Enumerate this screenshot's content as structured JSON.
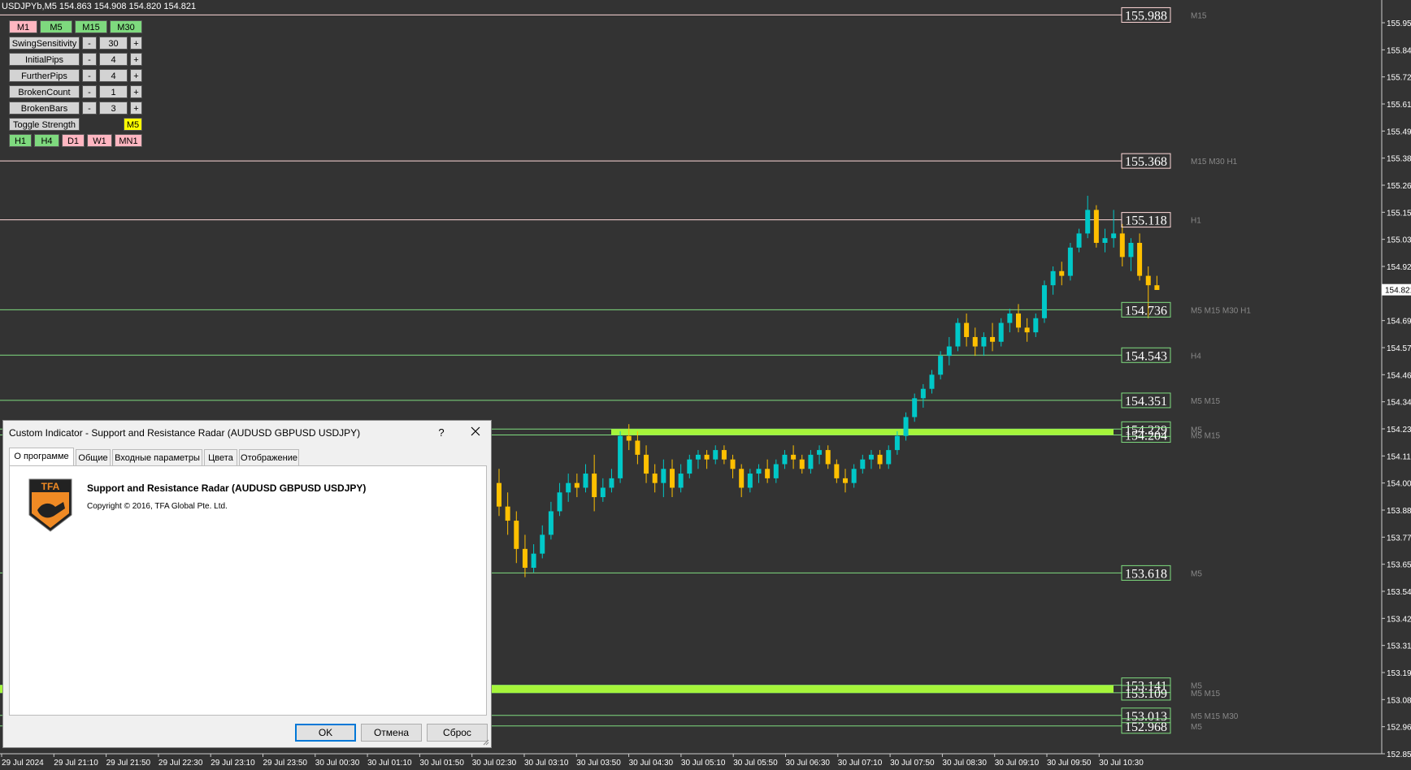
{
  "header": {
    "symbol": "USDJPYb,M5",
    "ohlc": "154.863 154.908 154.820 154.821"
  },
  "colors": {
    "background": "#333333",
    "bull": "#00c8c8",
    "bear": "#ffc000",
    "zone": "#a6f53a",
    "res_line": "#ffd8d8",
    "sup_line": "#7fdc7f"
  },
  "panel": {
    "top_tf": [
      {
        "label": "M1",
        "color": "pink"
      },
      {
        "label": "M5",
        "color": "green"
      },
      {
        "label": "M15",
        "color": "green"
      },
      {
        "label": "M30",
        "color": "green"
      }
    ],
    "params": [
      {
        "label": "SwingSensitivity",
        "minus": "-",
        "value": "30",
        "plus": "+"
      },
      {
        "label": "InitialPips",
        "minus": "-",
        "value": "4",
        "plus": "+"
      },
      {
        "label": "FurtherPips",
        "minus": "-",
        "value": "4",
        "plus": "+"
      },
      {
        "label": "BrokenCount",
        "minus": "-",
        "value": "1",
        "plus": "+"
      },
      {
        "label": "BrokenBars",
        "minus": "-",
        "value": "3",
        "plus": "+"
      }
    ],
    "toggle_label": "Toggle Strength",
    "toggle_tf": "M5",
    "bottom_tf": [
      {
        "label": "H1",
        "color": "green"
      },
      {
        "label": "H4",
        "color": "green"
      },
      {
        "label": "D1",
        "color": "pink"
      },
      {
        "label": "W1",
        "color": "pink"
      },
      {
        "label": "MN1",
        "color": "pink"
      }
    ]
  },
  "levels": [
    {
      "price": "155.988",
      "type": "res",
      "tf": "M15"
    },
    {
      "price": "155.368",
      "type": "res",
      "tf": "M15 M30 H1"
    },
    {
      "price": "155.118",
      "type": "res",
      "tf": "H1"
    },
    {
      "price": "154.736",
      "type": "sup",
      "tf": "M5 M15 M30 H1"
    },
    {
      "price": "154.543",
      "type": "sup",
      "tf": "H4"
    },
    {
      "price": "154.351",
      "type": "sup",
      "tf": "M5 M15"
    },
    {
      "price": "154.229",
      "type": "sup",
      "tf": "M5"
    },
    {
      "price": "154.204",
      "type": "sup",
      "tf": "M5 M15"
    },
    {
      "price": "153.618",
      "type": "sup",
      "tf": "M5"
    },
    {
      "price": "153.141",
      "type": "sup",
      "tf": "M5"
    },
    {
      "price": "153.109",
      "type": "sup",
      "tf": "M5 M15"
    },
    {
      "price": "153.013",
      "type": "sup",
      "tf": "M5 M15 M30"
    },
    {
      "price": "152.968",
      "type": "sup",
      "tf": "M5"
    }
  ],
  "price_axis": [
    "155.955",
    "155.840",
    "155.725",
    "155.610",
    "155.495",
    "155.380",
    "155.265",
    "155.150",
    "155.035",
    "154.920",
    "154.821",
    "154.690",
    "154.575",
    "154.460",
    "154.345",
    "154.230",
    "154.115",
    "154.000",
    "153.885",
    "153.770",
    "153.655",
    "153.540",
    "153.425",
    "153.310",
    "153.195",
    "153.080",
    "152.965",
    "152.850"
  ],
  "current_price": "154.821",
  "time_axis": [
    "29 Jul 2024",
    "29 Jul 21:10",
    "29 Jul 21:50",
    "29 Jul 22:30",
    "29 Jul 23:10",
    "29 Jul 23:50",
    "30 Jul 00:30",
    "30 Jul 01:10",
    "30 Jul 01:50",
    "30 Jul 02:30",
    "30 Jul 03:10",
    "30 Jul 03:50",
    "30 Jul 04:30",
    "30 Jul 05:10",
    "30 Jul 05:50",
    "30 Jul 06:30",
    "30 Jul 07:10",
    "30 Jul 07:50",
    "30 Jul 08:30",
    "30 Jul 09:10",
    "30 Jul 09:50",
    "30 Jul 10:30"
  ],
  "candles": [
    [
      154.0,
      154.06,
      153.86,
      153.9
    ],
    [
      153.9,
      153.96,
      153.78,
      153.84
    ],
    [
      153.84,
      153.88,
      153.66,
      153.72
    ],
    [
      153.72,
      153.78,
      153.6,
      153.64
    ],
    [
      153.64,
      153.74,
      153.62,
      153.7
    ],
    [
      153.7,
      153.82,
      153.68,
      153.78
    ],
    [
      153.78,
      153.92,
      153.76,
      153.88
    ],
    [
      153.88,
      154.0,
      153.86,
      153.96
    ],
    [
      153.96,
      154.04,
      153.92,
      154.0
    ],
    [
      154.0,
      154.04,
      153.94,
      153.98
    ],
    [
      153.98,
      154.08,
      153.96,
      154.04
    ],
    [
      154.04,
      154.12,
      153.88,
      153.94
    ],
    [
      153.94,
      154.02,
      153.92,
      153.98
    ],
    [
      153.98,
      154.06,
      153.96,
      154.02
    ],
    [
      154.02,
      154.22,
      154.0,
      154.2
    ],
    [
      154.2,
      154.25,
      154.14,
      154.18
    ],
    [
      154.18,
      154.22,
      154.08,
      154.12
    ],
    [
      154.12,
      154.16,
      154.0,
      154.04
    ],
    [
      154.04,
      154.08,
      153.96,
      154.0
    ],
    [
      154.0,
      154.1,
      153.94,
      154.06
    ],
    [
      154.06,
      154.1,
      153.94,
      153.98
    ],
    [
      153.98,
      154.08,
      153.96,
      154.04
    ],
    [
      154.04,
      154.12,
      154.02,
      154.1
    ],
    [
      154.1,
      154.14,
      154.06,
      154.12
    ],
    [
      154.12,
      154.14,
      154.06,
      154.1
    ],
    [
      154.1,
      154.16,
      154.08,
      154.14
    ],
    [
      154.14,
      154.16,
      154.08,
      154.1
    ],
    [
      154.1,
      154.12,
      154.02,
      154.06
    ],
    [
      154.06,
      154.08,
      153.94,
      153.98
    ],
    [
      153.98,
      154.06,
      153.96,
      154.04
    ],
    [
      154.04,
      154.08,
      154.0,
      154.06
    ],
    [
      154.06,
      154.1,
      154.0,
      154.02
    ],
    [
      154.02,
      154.1,
      154.0,
      154.08
    ],
    [
      154.08,
      154.14,
      154.06,
      154.12
    ],
    [
      154.12,
      154.16,
      154.06,
      154.1
    ],
    [
      154.1,
      154.12,
      154.04,
      154.06
    ],
    [
      154.06,
      154.14,
      154.04,
      154.12
    ],
    [
      154.12,
      154.16,
      154.08,
      154.14
    ],
    [
      154.14,
      154.16,
      154.06,
      154.08
    ],
    [
      154.08,
      154.1,
      154.0,
      154.02
    ],
    [
      154.02,
      154.06,
      153.96,
      154.0
    ],
    [
      154.0,
      154.08,
      153.98,
      154.06
    ],
    [
      154.06,
      154.12,
      154.04,
      154.1
    ],
    [
      154.1,
      154.14,
      154.06,
      154.12
    ],
    [
      154.12,
      154.14,
      154.06,
      154.08
    ],
    [
      154.08,
      154.16,
      154.06,
      154.14
    ],
    [
      154.14,
      154.22,
      154.12,
      154.2
    ],
    [
      154.2,
      154.3,
      154.18,
      154.28
    ],
    [
      154.28,
      154.38,
      154.26,
      154.36
    ],
    [
      154.36,
      154.42,
      154.32,
      154.4
    ],
    [
      154.4,
      154.48,
      154.38,
      154.46
    ],
    [
      154.46,
      154.56,
      154.44,
      154.54
    ],
    [
      154.54,
      154.62,
      154.5,
      154.58
    ],
    [
      154.58,
      154.7,
      154.56,
      154.68
    ],
    [
      154.68,
      154.72,
      154.58,
      154.62
    ],
    [
      154.62,
      154.66,
      154.54,
      154.58
    ],
    [
      154.58,
      154.64,
      154.54,
      154.62
    ],
    [
      154.62,
      154.68,
      154.56,
      154.6
    ],
    [
      154.6,
      154.7,
      154.58,
      154.68
    ],
    [
      154.68,
      154.74,
      154.64,
      154.72
    ],
    [
      154.72,
      154.76,
      154.64,
      154.66
    ],
    [
      154.66,
      154.7,
      154.6,
      154.64
    ],
    [
      154.64,
      154.72,
      154.62,
      154.7
    ],
    [
      154.7,
      154.86,
      154.68,
      154.84
    ],
    [
      154.84,
      154.92,
      154.8,
      154.9
    ],
    [
      154.9,
      154.94,
      154.84,
      154.88
    ],
    [
      154.88,
      155.02,
      154.86,
      155.0
    ],
    [
      155.0,
      155.08,
      154.98,
      155.06
    ],
    [
      155.06,
      155.22,
      155.04,
      155.16
    ],
    [
      155.16,
      155.18,
      155.0,
      155.02
    ],
    [
      155.02,
      155.08,
      154.98,
      155.04
    ],
    [
      155.04,
      155.16,
      155.0,
      155.06
    ],
    [
      155.06,
      155.1,
      154.92,
      154.96
    ],
    [
      154.96,
      155.04,
      154.9,
      155.02
    ],
    [
      155.02,
      155.06,
      154.86,
      154.88
    ],
    [
      154.88,
      154.92,
      154.7,
      154.84
    ],
    [
      154.84,
      154.88,
      154.82,
      154.82
    ]
  ],
  "dialog": {
    "title": "Custom Indicator - Support and Resistance Radar (AUDUSD GBPUSD USDJPY)",
    "help": "?",
    "tabs": [
      "О программе",
      "Общие",
      "Входные параметры",
      "Цвета",
      "Отображение"
    ],
    "program_name": "Support and Resistance Radar (AUDUSD GBPUSD USDJPY)",
    "copyright": "Copyright © 2016, TFA Global Pte. Ltd.",
    "logo_text": "TFA",
    "ok": "OK",
    "cancel": "Отмена",
    "reset": "Сброс"
  }
}
